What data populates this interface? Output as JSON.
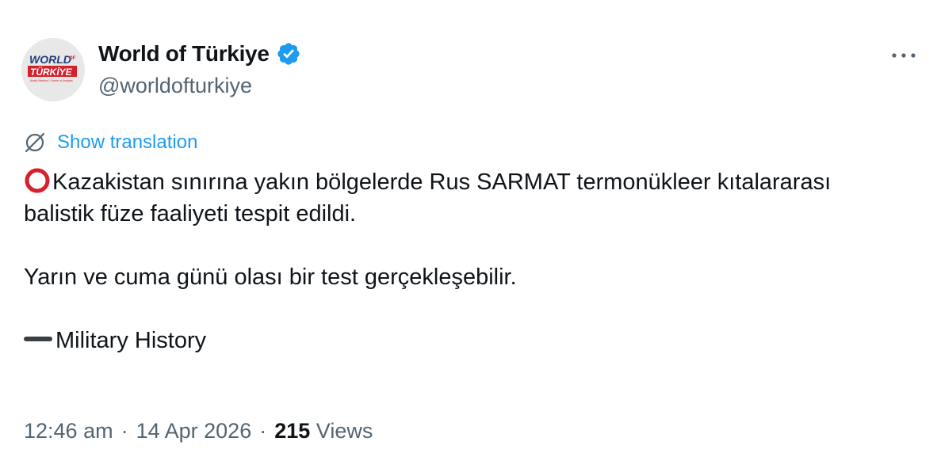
{
  "author": {
    "display_name": "World of Türkiye",
    "handle": "@worldofturkiye",
    "verified": true,
    "avatar_icon": "world-of-turkiye-logo",
    "avatar_logo_text_top": "WORLD",
    "avatar_logo_text_of": "OF",
    "avatar_logo_text_bottom": "TÜRKİYE",
    "avatar_logo_tagline": "Analiz Merkezi / Center of Analysis"
  },
  "more_icon": "more-horizontal-icon",
  "translation": {
    "icon": "translate-globe-icon",
    "label": "Show translation"
  },
  "tweet": {
    "line1_icon": "red-circle-emoji",
    "paragraph1": "Kazakistan sınırına yakın bölgelerde Rus SARMAT termonükleer kıtalararası balistik füze faaliyeti tespit edildi.",
    "paragraph2": "Yarın ve cuma günü olası bir test gerçekleşebilir.",
    "paragraph3_icon": "heavy-dash-emoji",
    "paragraph3": "Military History"
  },
  "meta": {
    "time": "12:46 am",
    "date": "14 Apr 2026",
    "views_count": "215",
    "views_label": "Views",
    "separator": "·"
  },
  "colors": {
    "text": "#0f1419",
    "secondary": "#536471",
    "link": "#1d9bf0",
    "verified": "#1d9bf0",
    "logo_red": "#d6202b",
    "logo_blue": "#1f3f7a"
  }
}
